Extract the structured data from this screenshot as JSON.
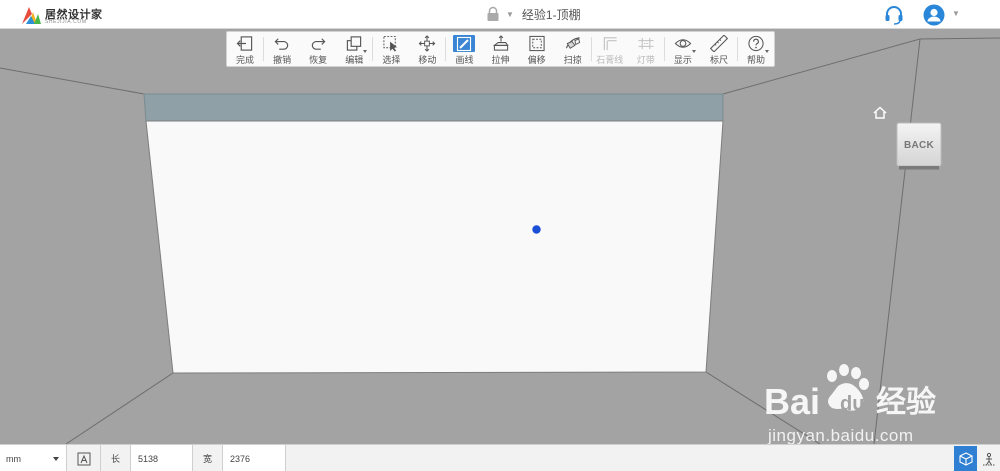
{
  "app": {
    "brand_name": "居然设计家",
    "brand_sub": "SHEJIJIA.COM",
    "doc_title": "经验1-顶棚"
  },
  "toolbar": {
    "items": [
      {
        "label": "完成",
        "icon": "exit-icon",
        "disabled": false
      },
      {
        "label": "撤销",
        "icon": "undo-icon",
        "disabled": false
      },
      {
        "label": "恢复",
        "icon": "redo-icon",
        "disabled": false
      },
      {
        "label": "编辑",
        "icon": "edit-icon",
        "disabled": false
      },
      {
        "label": "选择",
        "icon": "select-icon",
        "disabled": false
      },
      {
        "label": "移动",
        "icon": "move-icon",
        "disabled": false
      },
      {
        "label": "画线",
        "icon": "draw-line-icon",
        "disabled": false,
        "active": true
      },
      {
        "label": "拉伸",
        "icon": "extrude-icon",
        "disabled": false
      },
      {
        "label": "偏移",
        "icon": "offset-icon",
        "disabled": false
      },
      {
        "label": "扫掠",
        "icon": "sweep-icon",
        "disabled": false
      },
      {
        "label": "石膏线",
        "icon": "molding-icon",
        "disabled": true
      },
      {
        "label": "灯带",
        "icon": "light-strip-icon",
        "disabled": true
      },
      {
        "label": "显示",
        "icon": "eye-icon",
        "disabled": false
      },
      {
        "label": "标尺",
        "icon": "ruler-icon",
        "disabled": false
      },
      {
        "label": "帮助",
        "icon": "help-icon",
        "disabled": false
      }
    ]
  },
  "viewcube": {
    "label": "BACK"
  },
  "watermark": {
    "logo_text": "Bai du 经验",
    "url": "jingyan.baidu.com"
  },
  "statusbar": {
    "unit": "mm",
    "length_label": "长",
    "length_value": "5138",
    "width_label": "宽",
    "width_value": "2376"
  },
  "colors": {
    "accent": "#3a86d4",
    "ceiling_face": "#f9f9f9",
    "wall": "#a3a3a3",
    "cornice": "#8fa1a6",
    "cursor_point": "#1a4fd6"
  }
}
